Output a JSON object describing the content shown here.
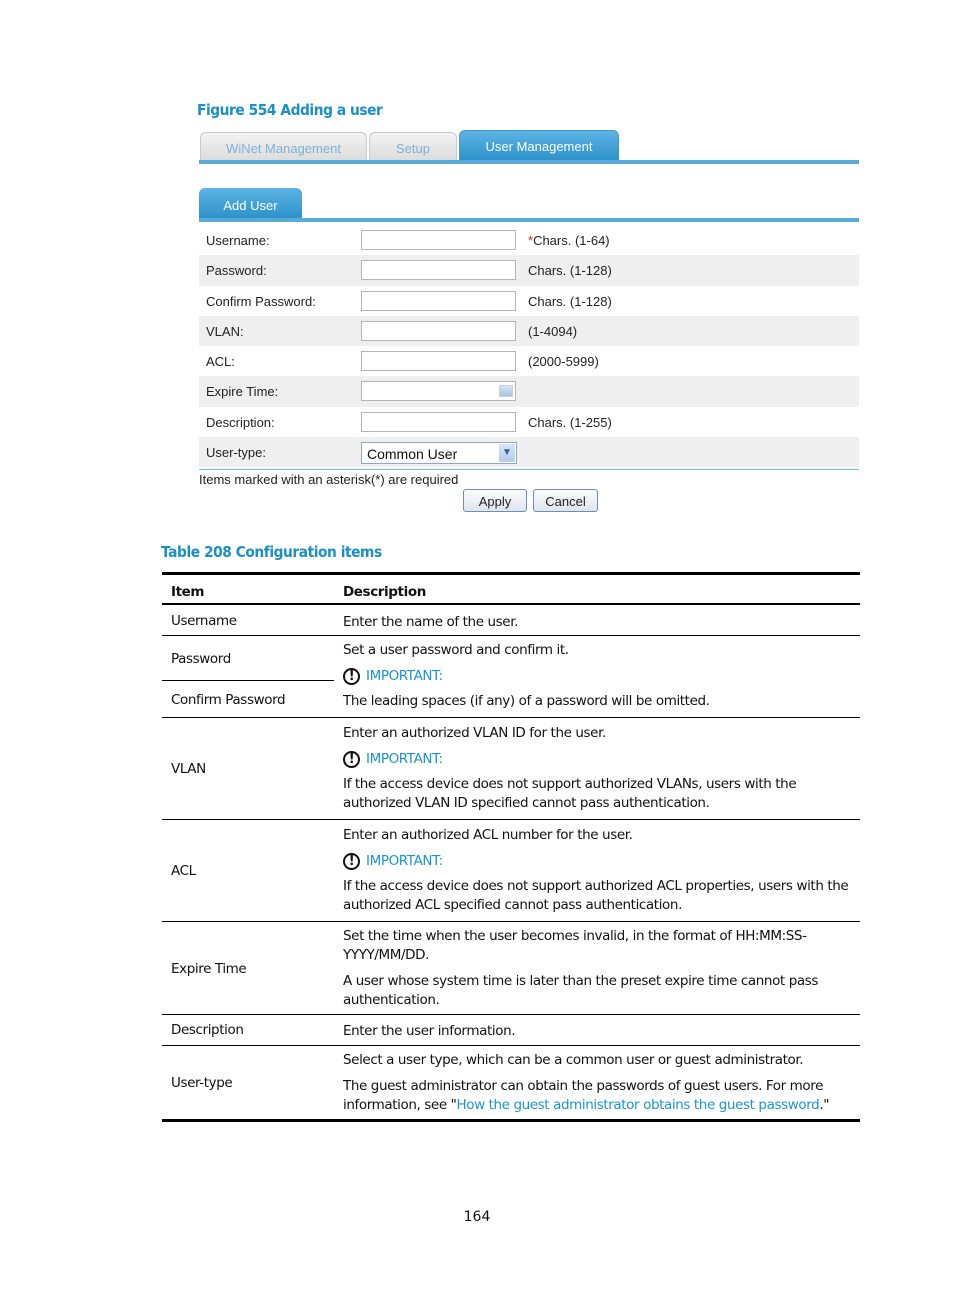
{
  "figure_title": "Figure 554 Adding a user",
  "ui": {
    "tabs": [
      {
        "label": "WiNet Management",
        "active": false
      },
      {
        "label": "Setup",
        "active": false
      },
      {
        "label": "User Management",
        "active": true
      }
    ],
    "subtab": "Add User",
    "fields": [
      {
        "label": "Username:",
        "value": "",
        "hint_required": "*",
        "hint": "Chars. (1-64)"
      },
      {
        "label": "Password:",
        "value": "",
        "hint_required": "",
        "hint": "Chars. (1-128)"
      },
      {
        "label": "Confirm Password:",
        "value": "",
        "hint_required": "",
        "hint": "Chars. (1-128)"
      },
      {
        "label": "VLAN:",
        "value": "",
        "hint_required": "",
        "hint": "(1-4094)"
      },
      {
        "label": "ACL:",
        "value": "",
        "hint_required": "",
        "hint": "(2000-5999)"
      },
      {
        "label": "Expire Time:",
        "value": "",
        "hint_required": "",
        "hint": ""
      },
      {
        "label": "Description:",
        "value": "",
        "hint_required": "",
        "hint": "Chars. (1-255)"
      },
      {
        "label": "User-type:",
        "value": "Common User",
        "hint_required": "",
        "hint": ""
      }
    ],
    "required_note": "Items marked with an asterisk(*) are required",
    "apply_label": "Apply",
    "cancel_label": "Cancel"
  },
  "table_title": "Table 208 Configuration items",
  "table": {
    "headers": [
      "Item",
      "Description"
    ],
    "important_label": "IMPORTANT:",
    "rows": {
      "username": {
        "item": "Username",
        "desc": "Enter the name of the user."
      },
      "password": {
        "item": "Password",
        "item2": "Confirm Password",
        "desc1": "Set a user password and confirm it.",
        "desc2": "The leading spaces (if any) of a password will be omitted."
      },
      "vlan": {
        "item": "VLAN",
        "desc1": "Enter an authorized VLAN ID for the user.",
        "desc2": "If the access device does not support authorized VLANs, users with the authorized VLAN ID specified cannot pass authentication."
      },
      "acl": {
        "item": "ACL",
        "desc1": "Enter an authorized ACL number for the user.",
        "desc2": "If the access device does not support authorized ACL properties, users with the authorized ACL specified cannot pass authentication."
      },
      "expire": {
        "item": "Expire Time",
        "desc1": "Set the time when the user becomes invalid, in the format of HH:MM:SS-YYYY/MM/DD.",
        "desc2": "A user whose system time is later than the preset expire time cannot pass authentication."
      },
      "description": {
        "item": "Description",
        "desc": "Enter the user information."
      },
      "usertype": {
        "item": "User-type",
        "desc1": "Select a user type, which can be a common user or guest administrator.",
        "desc2_pre": "The guest administrator can obtain the passwords of guest users. For more information, see \"",
        "desc2_link": "How the guest administrator obtains the guest password",
        "desc2_post": ".\""
      }
    }
  },
  "page_number": "164"
}
